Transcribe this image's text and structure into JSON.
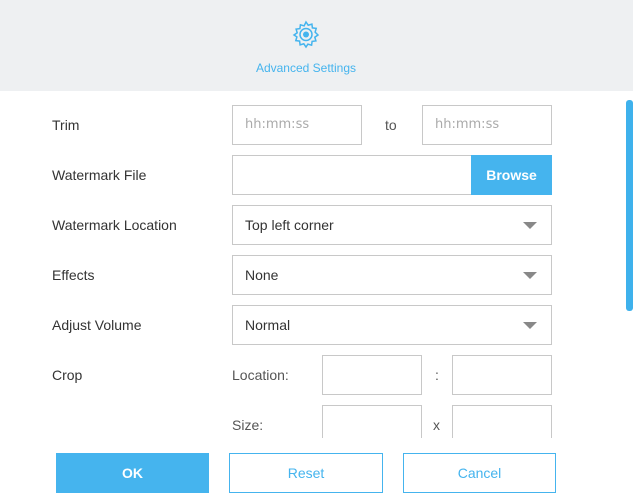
{
  "header": {
    "title": "Advanced Settings",
    "icon": "gear-icon"
  },
  "trim": {
    "label": "Trim",
    "start_placeholder": "hh:mm:ss",
    "separator": "to",
    "end_placeholder": "hh:mm:ss"
  },
  "watermark_file": {
    "label": "Watermark File",
    "value": "",
    "browse_label": "Browse"
  },
  "watermark_location": {
    "label": "Watermark Location",
    "selected": "Top left corner"
  },
  "effects": {
    "label": "Effects",
    "selected": "None"
  },
  "adjust_volume": {
    "label": "Adjust Volume",
    "selected": "Normal"
  },
  "crop": {
    "label": "Crop",
    "location_label": "Location:",
    "location_separator": ":",
    "size_label": "Size:",
    "size_separator": "x"
  },
  "buttons": {
    "ok": "OK",
    "reset": "Reset",
    "cancel": "Cancel"
  },
  "colors": {
    "accent": "#45b4ee",
    "header_bg": "#eef0f2",
    "border": "#c8c8c8"
  }
}
